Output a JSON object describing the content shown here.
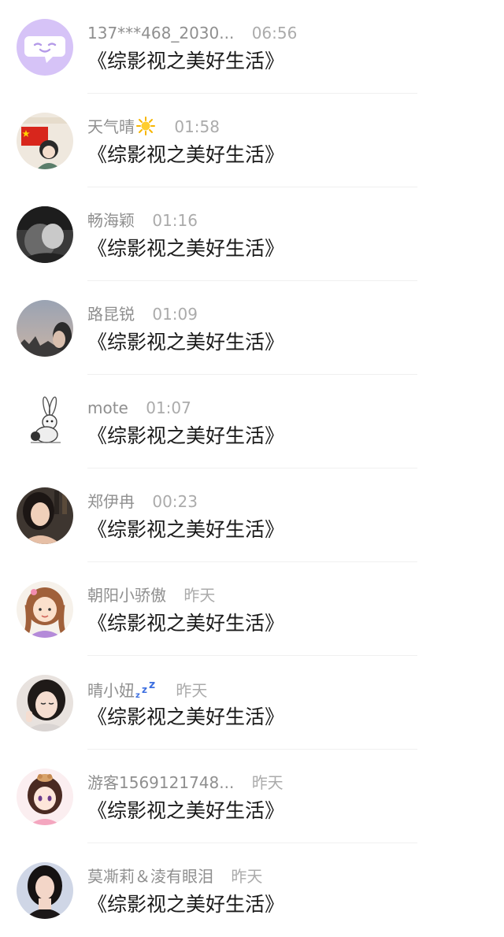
{
  "conversations": [
    {
      "name": "137***468_2030...",
      "time": "06:56",
      "message": "《综影视之美好生活》",
      "avatar": "default-chat-avatar"
    },
    {
      "name": "天气晴",
      "name_emoji": "sun-emoji",
      "time": "01:58",
      "message": "《综影视之美好生活》",
      "avatar": "user-avatar-photo"
    },
    {
      "name": "畅海颖",
      "time": "01:16",
      "message": "《综影视之美好生活》",
      "avatar": "user-avatar-photo"
    },
    {
      "name": "路昆锐",
      "time": "01:09",
      "message": "《综影视之美好生活》",
      "avatar": "user-avatar-photo"
    },
    {
      "name": "mote",
      "time": "01:07",
      "message": "《综影视之美好生活》",
      "avatar": "rabbit-sketch-avatar"
    },
    {
      "name": "郑伊冉",
      "time": "00:23",
      "message": "《综影视之美好生活》",
      "avatar": "user-avatar-photo"
    },
    {
      "name": "朝阳小骄傲",
      "time": "昨天",
      "message": "《综影视之美好生活》",
      "avatar": "cartoon-girl-avatar"
    },
    {
      "name": "晴小妞",
      "name_emoji": "zzz-sleep-emoji",
      "time": "昨天",
      "message": "《综影视之美好生活》",
      "avatar": "user-avatar-photo"
    },
    {
      "name": "游客1569121748...",
      "time": "昨天",
      "message": "《综影视之美好生活》",
      "avatar": "anime-girl-avatar"
    },
    {
      "name": "莫凘莉＆淩有眼泪",
      "time": "昨天",
      "message": "《综影视之美好生活》",
      "avatar": "user-avatar-photo"
    }
  ],
  "colors": {
    "default_avatar_bg": "#d6c3f7",
    "name_text": "#8f8f8f",
    "time_text": "#ababab",
    "message_text": "#1a1a1a",
    "divider": "#f0f0f0",
    "zzz_blue": "#3d6fe0",
    "sun_yellow": "#f7b500"
  }
}
